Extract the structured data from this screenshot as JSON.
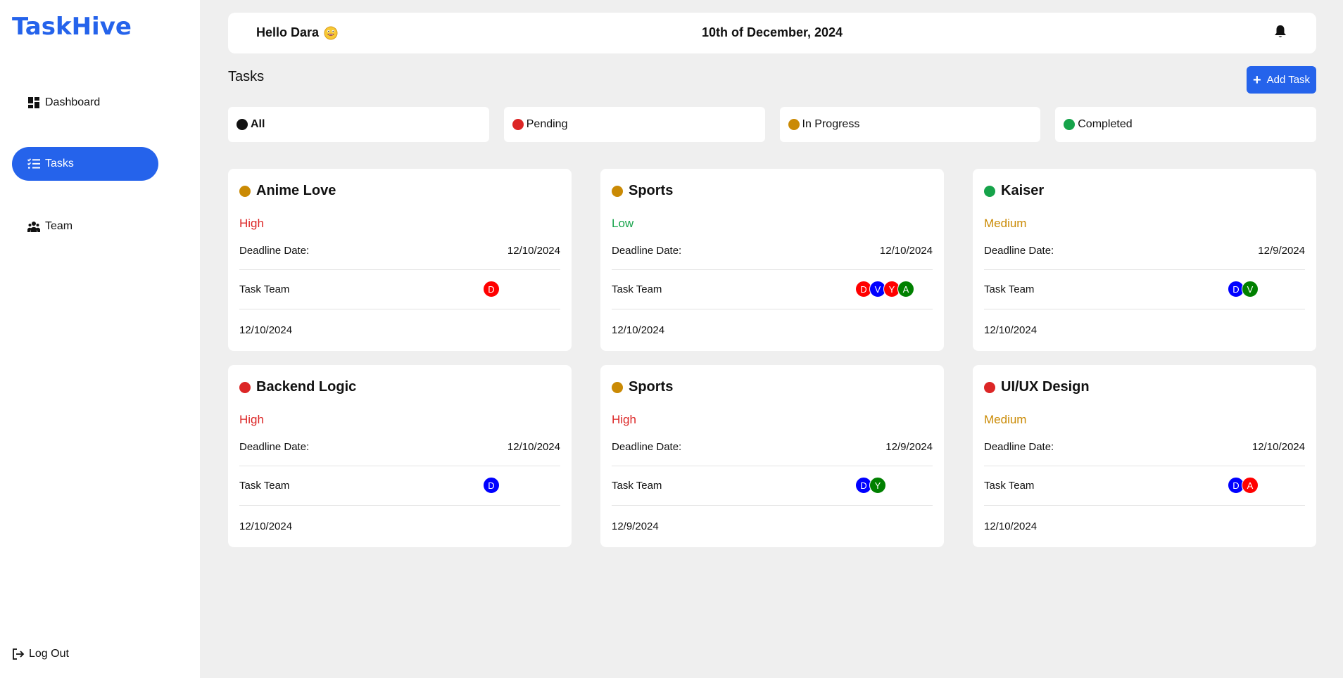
{
  "app": {
    "name": "TaskHive",
    "brand_color": "#2563eb"
  },
  "sidebar": {
    "items": [
      {
        "label": "Dashboard",
        "icon": "dashboard-icon",
        "active": false
      },
      {
        "label": "Tasks",
        "icon": "task-list-icon",
        "active": true
      },
      {
        "label": "Team",
        "icon": "team-icon",
        "active": false
      }
    ],
    "logout_label": "Log Out"
  },
  "header": {
    "greeting": "Hello Dara",
    "date": "10th of December, 2024",
    "bell_icon": "bell-icon"
  },
  "tasks_section": {
    "title": "Tasks",
    "add_button_label": "Add Task"
  },
  "filters": [
    {
      "label": "All",
      "color": "#111111",
      "selected": true
    },
    {
      "label": "Pending",
      "color": "#dc2626",
      "selected": false
    },
    {
      "label": "In Progress",
      "color": "#ca8a04",
      "selected": false
    },
    {
      "label": "Completed",
      "color": "#16a34a",
      "selected": false
    }
  ],
  "labels": {
    "deadline": "Deadline Date:",
    "team": "Task Team"
  },
  "cards": [
    {
      "title": "Anime Love",
      "status_color": "#ca8a04",
      "priority": "High",
      "priority_color": "#dc2626",
      "deadline": "12/10/2024",
      "created": "12/10/2024",
      "team": [
        {
          "initial": "D",
          "color": "#ff0000"
        }
      ]
    },
    {
      "title": "Sports",
      "status_color": "#ca8a04",
      "priority": "Low",
      "priority_color": "#16a34a",
      "deadline": "12/10/2024",
      "created": "12/10/2024",
      "team": [
        {
          "initial": "D",
          "color": "#ff0000"
        },
        {
          "initial": "V",
          "color": "#0000ff"
        },
        {
          "initial": "Y",
          "color": "#ff0000"
        },
        {
          "initial": "A",
          "color": "#008000"
        }
      ]
    },
    {
      "title": "Kaiser",
      "status_color": "#16a34a",
      "priority": "Medium",
      "priority_color": "#ca8a04",
      "deadline": "12/9/2024",
      "created": "12/10/2024",
      "team": [
        {
          "initial": "D",
          "color": "#0000ff"
        },
        {
          "initial": "V",
          "color": "#008000"
        }
      ]
    },
    {
      "title": "Backend Logic",
      "status_color": "#dc2626",
      "priority": "High",
      "priority_color": "#dc2626",
      "deadline": "12/10/2024",
      "created": "12/10/2024",
      "team": [
        {
          "initial": "D",
          "color": "#0000ff"
        }
      ]
    },
    {
      "title": "Sports",
      "status_color": "#ca8a04",
      "priority": "High",
      "priority_color": "#dc2626",
      "deadline": "12/9/2024",
      "created": "12/9/2024",
      "team": [
        {
          "initial": "D",
          "color": "#0000ff"
        },
        {
          "initial": "Y",
          "color": "#008000"
        }
      ]
    },
    {
      "title": "UI/UX Design",
      "status_color": "#dc2626",
      "priority": "Medium",
      "priority_color": "#ca8a04",
      "deadline": "12/10/2024",
      "created": "12/10/2024",
      "team": [
        {
          "initial": "D",
          "color": "#0000ff"
        },
        {
          "initial": "A",
          "color": "#ff0000"
        }
      ]
    }
  ]
}
